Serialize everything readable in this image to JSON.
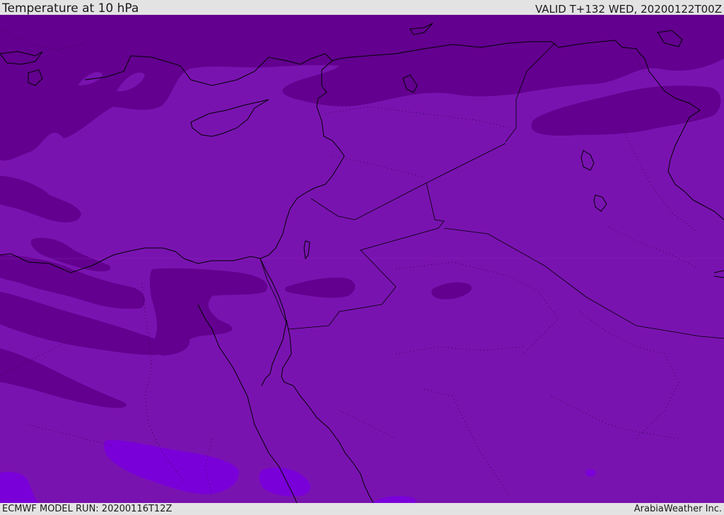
{
  "header": {
    "title": "Temperature at 10 hPa",
    "valid": "VALID T+132 WED, 20200122T00Z"
  },
  "footer": {
    "model_run": "ECMWF MODEL RUN: 20200116T12Z",
    "credit": "ArabiaWeather Inc."
  },
  "map": {
    "parameter": "temperature",
    "level": "10 hPa",
    "colors": {
      "base": "#7913b0",
      "cold": "#63008f",
      "warm": "#7a00d9",
      "coastline": "#000000"
    }
  }
}
